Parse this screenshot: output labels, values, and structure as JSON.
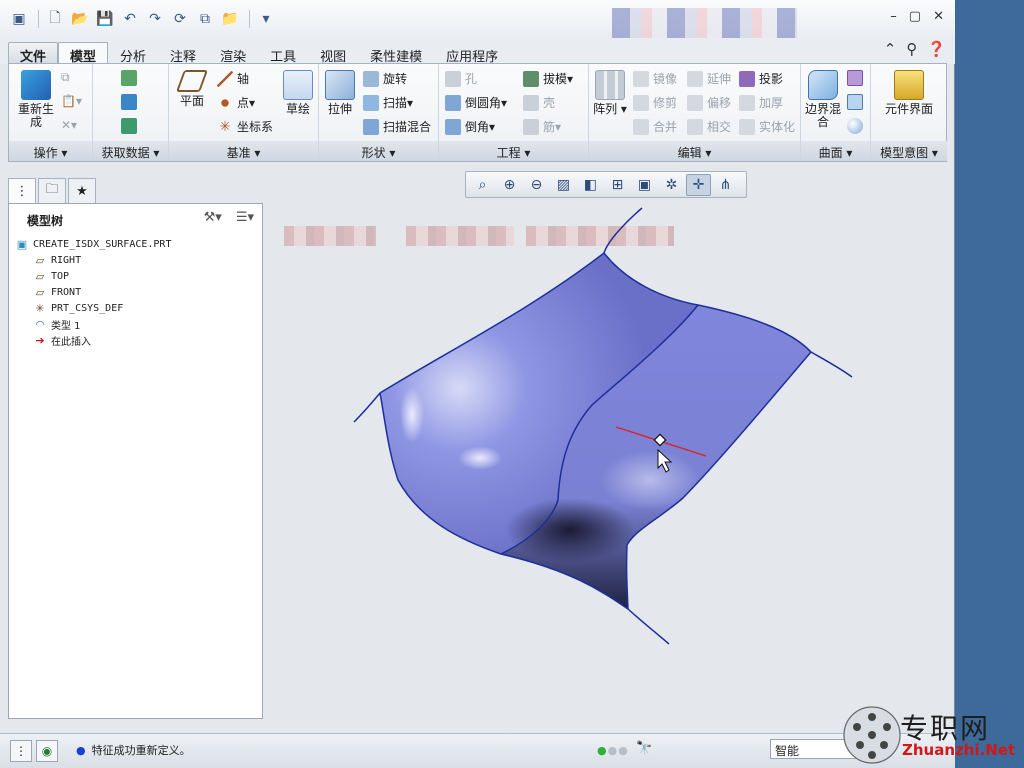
{
  "quick_access": {
    "icons": [
      "app-icon",
      "new-icon",
      "open-icon",
      "save-icon",
      "undo-icon",
      "redo-icon",
      "regenerate-icon",
      "windows-icon",
      "close-window-icon",
      "customize-icon"
    ]
  },
  "window_controls": {
    "minimize": "–",
    "restore": "▢",
    "close": "✕"
  },
  "tabs": [
    {
      "label": "文件"
    },
    {
      "label": "模型"
    },
    {
      "label": "分析"
    },
    {
      "label": "注释"
    },
    {
      "label": "渲染"
    },
    {
      "label": "工具"
    },
    {
      "label": "视图"
    },
    {
      "label": "柔性建模"
    },
    {
      "label": "应用程序"
    }
  ],
  "ribbon": {
    "groups": {
      "operations": "操作",
      "get_data": "获取数据",
      "datum": "基准",
      "shapes": "形状",
      "engineering": "工程",
      "editing": "编辑",
      "surfaces": "曲面",
      "model_intent": "模型意图"
    },
    "regenerate": "重新生成",
    "plane": "平面",
    "axis": "轴",
    "point": "点",
    "csys": "坐标系",
    "sketch": "草绘",
    "extrude": "拉伸",
    "revolve": "旋转",
    "sweep": "扫描",
    "swept_blend": "扫描混合",
    "hole": "孔",
    "round": "倒圆角",
    "chamfer": "倒角",
    "draft": "拔模",
    "shell": "壳",
    "rib": "筋",
    "pattern": "阵列",
    "mirror": "镜像",
    "extend": "延伸",
    "project": "投影",
    "trim": "修剪",
    "offset": "偏移",
    "thicken": "加厚",
    "merge": "合并",
    "intersect": "相交",
    "solidify": "实体化",
    "boundary_blend": "边界混合",
    "component_interface": "元件界面"
  },
  "model_tree": {
    "title": "模型树",
    "items": [
      {
        "label": "CREATE_ISDX_SURFACE.PRT",
        "icon": "part-icon"
      },
      {
        "label": "RIGHT",
        "icon": "datum-plane-icon"
      },
      {
        "label": "TOP",
        "icon": "datum-plane-icon"
      },
      {
        "label": "FRONT",
        "icon": "datum-plane-icon"
      },
      {
        "label": "PRT_CSYS_DEF",
        "icon": "csys-icon"
      },
      {
        "label": "类型 1",
        "icon": "style-feature-icon"
      },
      {
        "label": "在此插入",
        "icon": "insert-here-icon"
      }
    ]
  },
  "status": {
    "message": "特征成功重新定义。",
    "filter": "智能"
  },
  "watermark": {
    "brand": "专职网",
    "url": "Zhuanzhi.Net"
  },
  "colors": {
    "surface": "#7f86dc",
    "edge": "#1d2f9a",
    "accent": "#2e5c9a"
  }
}
